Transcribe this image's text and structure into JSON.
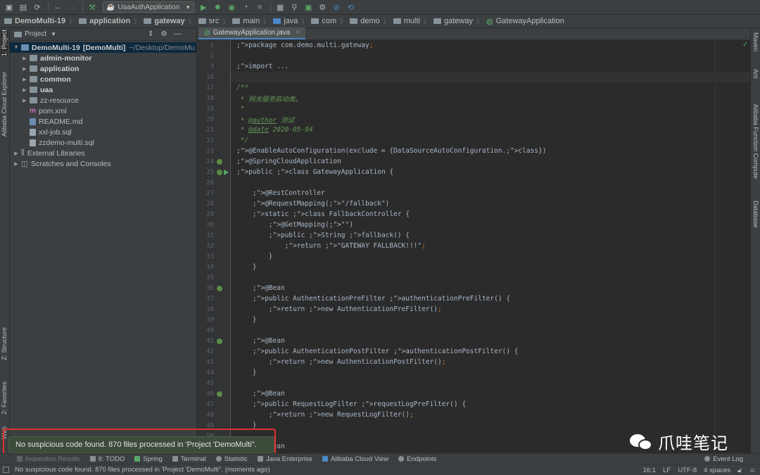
{
  "toolbar": {
    "run_config": "UaaAuthApplication",
    "icons": [
      "save-icon",
      "sync-icon",
      "refresh-icon",
      "back-icon",
      "forward-icon",
      "build-icon",
      "run-icon",
      "debug-icon",
      "coverage-icon",
      "profile-icon",
      "stop-icon",
      "structure-icon",
      "search-icon",
      "terminal-icon",
      "settings-icon",
      "sync-gradle-icon"
    ]
  },
  "breadcrumb": [
    {
      "label": "DemoMulti-19",
      "bold": true
    },
    {
      "label": "application",
      "bold": true
    },
    {
      "label": "gateway",
      "bold": true
    },
    {
      "label": "src",
      "bold": false
    },
    {
      "label": "main",
      "bold": false
    },
    {
      "label": "java",
      "bold": false
    },
    {
      "label": "com",
      "bold": false
    },
    {
      "label": "demo",
      "bold": false
    },
    {
      "label": "multi",
      "bold": false
    },
    {
      "label": "gateway",
      "bold": false
    },
    {
      "label": "GatewayApplication",
      "bold": false
    }
  ],
  "left_strip": {
    "project": "1: Project",
    "alibaba": "Alibaba Cloud Explorer",
    "structure": "Z: Structure",
    "favorites": "2: Favorites",
    "web": "Web"
  },
  "right_strip": {
    "maven": "Maven",
    "ant": "Ant",
    "alibaba_fc": "Alibaba Function Compute",
    "database": "Database"
  },
  "project_panel": {
    "title": "Project",
    "root_name": "DemoMulti-19",
    "root_module": "[DemoMulti]",
    "root_path": "~/Desktop/DemoMu",
    "items": [
      {
        "label": "admin-monitor",
        "type": "module"
      },
      {
        "label": "application",
        "type": "module"
      },
      {
        "label": "common",
        "type": "module"
      },
      {
        "label": "uaa",
        "type": "module"
      },
      {
        "label": "zz-resource",
        "type": "folder"
      },
      {
        "label": "pom.xml",
        "type": "file"
      },
      {
        "label": "README.md",
        "type": "file"
      },
      {
        "label": "xxl-job.sql",
        "type": "file"
      },
      {
        "label": "zzdemo-multi.sql",
        "type": "file"
      }
    ],
    "external_libraries": "External Libraries",
    "scratches": "Scratches and Consoles"
  },
  "editor": {
    "tab_label": "GatewayApplication.java",
    "lines": [
      {
        "n": "1",
        "code": "package com.demo.multi.gateway;",
        "style": "pkg"
      },
      {
        "n": "2",
        "code": "",
        "style": "plain"
      },
      {
        "n": "3",
        "code": "import ...",
        "style": "kw"
      },
      {
        "n": "16",
        "code": "",
        "style": "cur"
      },
      {
        "n": "17",
        "code": "/**",
        "style": "doc"
      },
      {
        "n": "18",
        "code": " * 网关服务启动类。",
        "style": "doc"
      },
      {
        "n": "19",
        "code": " *",
        "style": "doc"
      },
      {
        "n": "20",
        "code": " * @author 测试",
        "style": "doc"
      },
      {
        "n": "21",
        "code": " * @date 2020-05-04",
        "style": "doc"
      },
      {
        "n": "22",
        "code": " */",
        "style": "doc"
      },
      {
        "n": "23",
        "code": "@EnableAutoConfiguration(exclude = {DataSourceAutoConfiguration.class})",
        "style": "anno"
      },
      {
        "n": "24",
        "code": "@SpringCloudApplication",
        "style": "anno"
      },
      {
        "n": "25",
        "code": "public class GatewayApplication {",
        "style": "kw"
      },
      {
        "n": "26",
        "code": "",
        "style": "plain"
      },
      {
        "n": "27",
        "code": "    @RestController",
        "style": "anno"
      },
      {
        "n": "28",
        "code": "    @RequestMapping(\"/fallback\")",
        "style": "anno"
      },
      {
        "n": "29",
        "code": "    static class FallbackController {",
        "style": "kw"
      },
      {
        "n": "30",
        "code": "        @GetMapping(\"\")",
        "style": "anno"
      },
      {
        "n": "31",
        "code": "        public String fallback() {",
        "style": "kw"
      },
      {
        "n": "32",
        "code": "            return \"GATEWAY FALLBACK!!!\";",
        "style": "str"
      },
      {
        "n": "33",
        "code": "        }",
        "style": "plain"
      },
      {
        "n": "34",
        "code": "    }",
        "style": "plain"
      },
      {
        "n": "35",
        "code": "",
        "style": "plain"
      },
      {
        "n": "36",
        "code": "    @Bean",
        "style": "anno"
      },
      {
        "n": "37",
        "code": "    public AuthenticationPreFilter authenticationPreFilter() {",
        "style": "kw"
      },
      {
        "n": "38",
        "code": "        return new AuthenticationPreFilter();",
        "style": "kw"
      },
      {
        "n": "39",
        "code": "    }",
        "style": "plain"
      },
      {
        "n": "40",
        "code": "",
        "style": "plain"
      },
      {
        "n": "41",
        "code": "    @Bean",
        "style": "anno"
      },
      {
        "n": "42",
        "code": "    public AuthenticationPostFilter authenticationPostFilter() {",
        "style": "kw"
      },
      {
        "n": "43",
        "code": "        return new AuthenticationPostFilter();",
        "style": "kw"
      },
      {
        "n": "44",
        "code": "    }",
        "style": "plain"
      },
      {
        "n": "45",
        "code": "",
        "style": "plain"
      },
      {
        "n": "46",
        "code": "    @Bean",
        "style": "anno"
      },
      {
        "n": "47",
        "code": "    public RequestLogFilter requestLogPreFilter() {",
        "style": "kw"
      },
      {
        "n": "48",
        "code": "        return new RequestLogFilter();",
        "style": "kw"
      },
      {
        "n": "49",
        "code": "    }",
        "style": "plain"
      },
      {
        "n": "50",
        "code": "",
        "style": "plain"
      },
      {
        "n": "51",
        "code": "    @Bean",
        "style": "anno"
      }
    ]
  },
  "toolwindows": [
    {
      "label": "Inspection Results"
    },
    {
      "label": "6: TODO"
    },
    {
      "label": "Spring"
    },
    {
      "label": "Terminal"
    },
    {
      "label": "Statistic"
    },
    {
      "label": "Java Enterprise"
    },
    {
      "label": "Alibaba Cloud View"
    },
    {
      "label": "Endpoints"
    }
  ],
  "event_log": "Event Log",
  "balloon": "No suspicious code found. 870 files processed in 'Project 'DemoMulti''.",
  "status": {
    "message": "No suspicious code found. 870 files processed in 'Project 'DemoMulti''. (moments ago)",
    "position": "16:1",
    "line_sep": "LF",
    "encoding": "UTF-8",
    "indent": "4 spaces"
  },
  "watermark": "爪哇笔记",
  "colors": {
    "keyword": "#cc7832",
    "annotation": "#bbb529",
    "string": "#6a8759",
    "doc": "#629755",
    "text": "#a9b7c6",
    "method": "#ffc66d",
    "highlight": "#e0302e"
  }
}
